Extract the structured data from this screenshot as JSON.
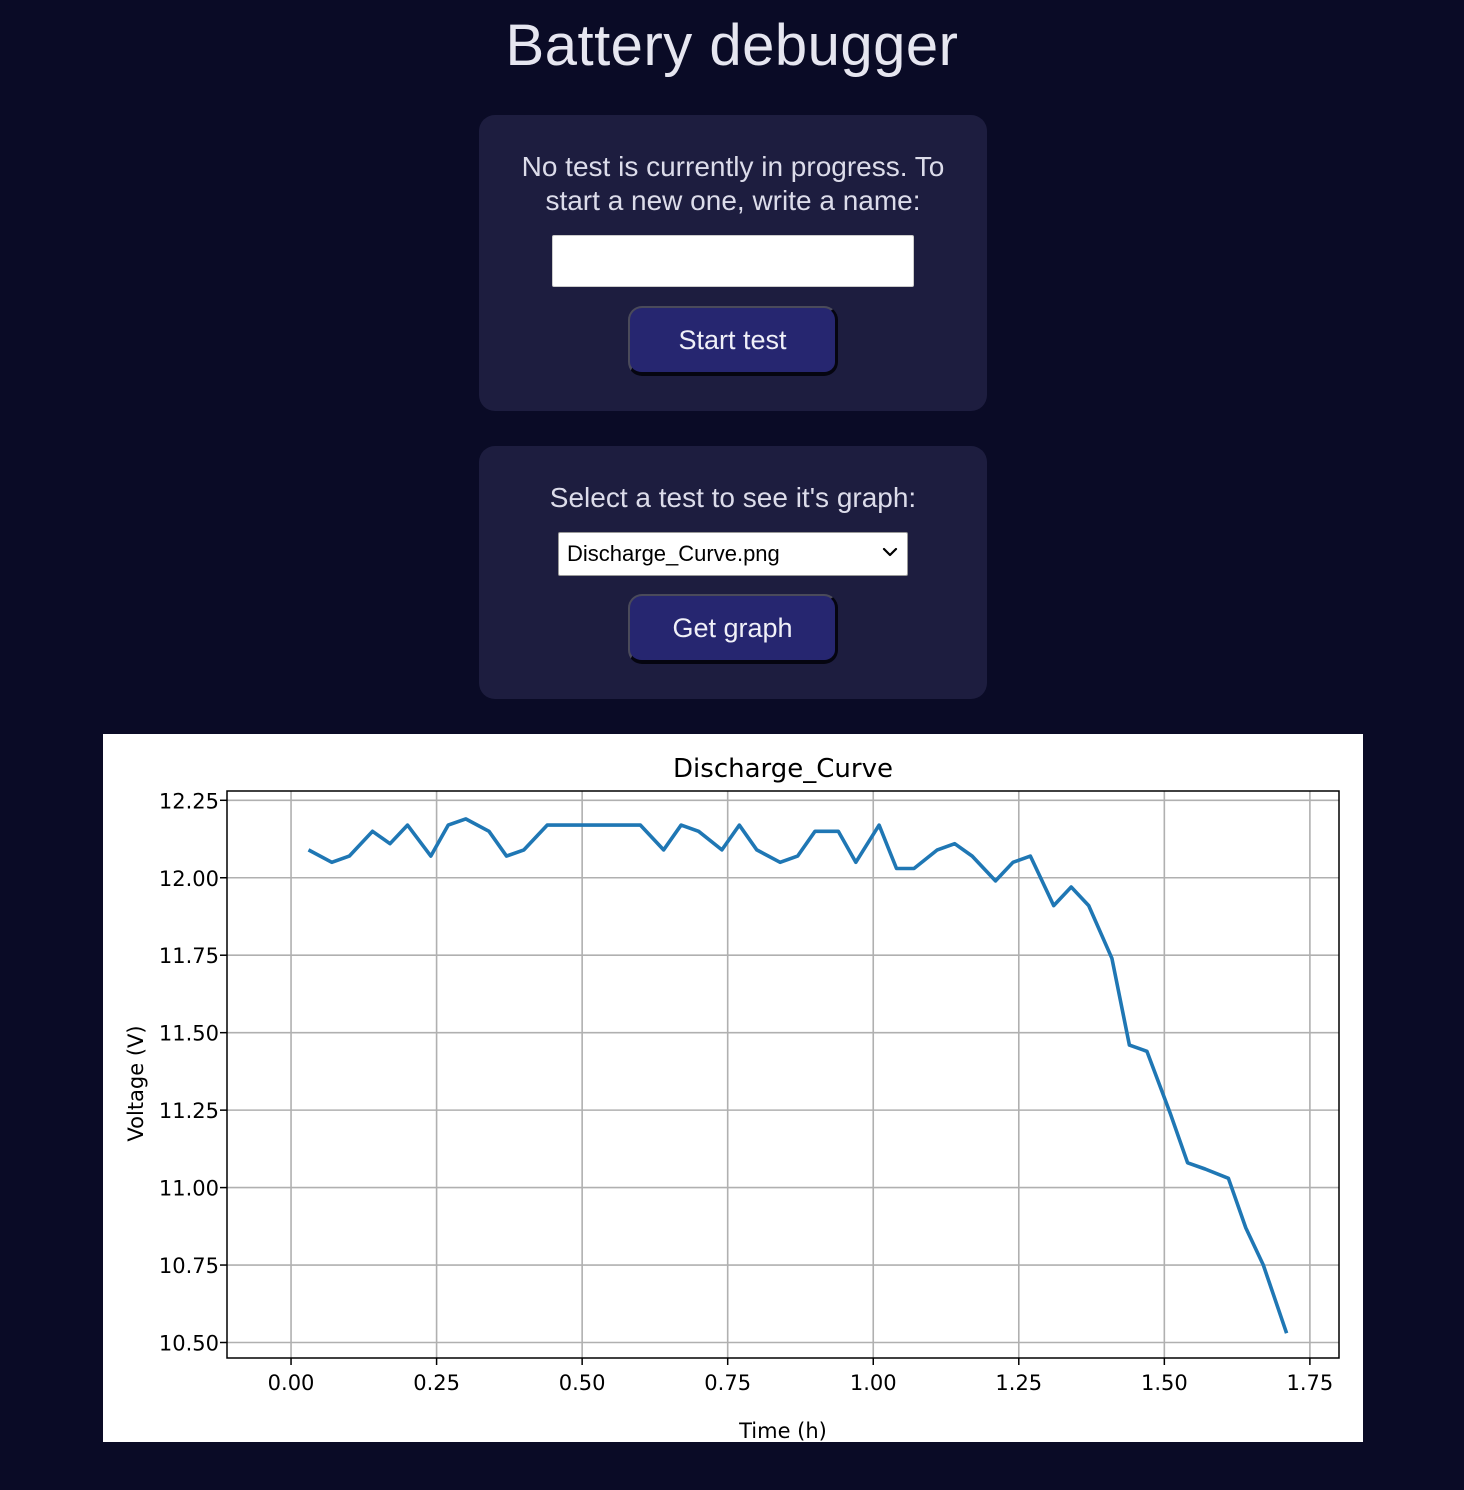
{
  "header": {
    "title": "Battery debugger"
  },
  "new_test": {
    "message_line1": "No test is currently in progress. To",
    "message_line2": "start a new one, write a name:",
    "name_value": "",
    "start_label": "Start test"
  },
  "select_test": {
    "prompt": "Select a test to see it's graph:",
    "selected": "Discharge_Curve.png",
    "get_graph_label": "Get graph"
  },
  "colors": {
    "background": "#0a0b26",
    "card": "#1d1d3f",
    "button": "#262670",
    "line": "#1f77b4"
  },
  "icons": {
    "dropdown": "chevron-down-icon"
  },
  "chart_data": {
    "type": "line",
    "title": "Discharge_Curve",
    "xlabel": "Time (h)",
    "ylabel": "Voltage (V)",
    "xlim": [
      -0.11,
      1.8
    ],
    "ylim": [
      10.45,
      12.28
    ],
    "grid": true,
    "xticks": [
      0.0,
      0.25,
      0.5,
      0.75,
      1.0,
      1.25,
      1.5,
      1.75
    ],
    "xtick_labels": [
      "0.00",
      "0.25",
      "0.50",
      "0.75",
      "1.00",
      "1.25",
      "1.50",
      "1.75"
    ],
    "yticks": [
      10.5,
      10.75,
      11.0,
      11.25,
      11.5,
      11.75,
      12.0,
      12.25
    ],
    "ytick_labels": [
      "10.50",
      "10.75",
      "11.00",
      "11.25",
      "11.50",
      "11.75",
      "12.00",
      "12.25"
    ],
    "series": [
      {
        "x": [
          0.03,
          0.07,
          0.1,
          0.14,
          0.17,
          0.2,
          0.24,
          0.27,
          0.3,
          0.34,
          0.37,
          0.4,
          0.44,
          0.47,
          0.5,
          0.54,
          0.57,
          0.6,
          0.64,
          0.67,
          0.7,
          0.74,
          0.77,
          0.8,
          0.84,
          0.87,
          0.9,
          0.94,
          0.97,
          1.01,
          1.04,
          1.07,
          1.11,
          1.14,
          1.17,
          1.21,
          1.24,
          1.27,
          1.31,
          1.34,
          1.37,
          1.41,
          1.44,
          1.47,
          1.51,
          1.54,
          1.57,
          1.61,
          1.64,
          1.67,
          1.71
        ],
        "y": [
          12.09,
          12.05,
          12.07,
          12.15,
          12.11,
          12.17,
          12.07,
          12.17,
          12.19,
          12.15,
          12.07,
          12.09,
          12.17,
          12.17,
          12.17,
          12.17,
          12.17,
          12.17,
          12.09,
          12.17,
          12.15,
          12.09,
          12.17,
          12.09,
          12.05,
          12.07,
          12.15,
          12.15,
          12.05,
          12.17,
          12.03,
          12.03,
          12.09,
          12.11,
          12.07,
          11.99,
          12.05,
          12.07,
          11.91,
          11.97,
          11.91,
          11.74,
          11.46,
          11.44,
          11.24,
          11.08,
          11.06,
          11.03,
          10.87,
          10.75,
          10.53
        ]
      }
    ]
  }
}
